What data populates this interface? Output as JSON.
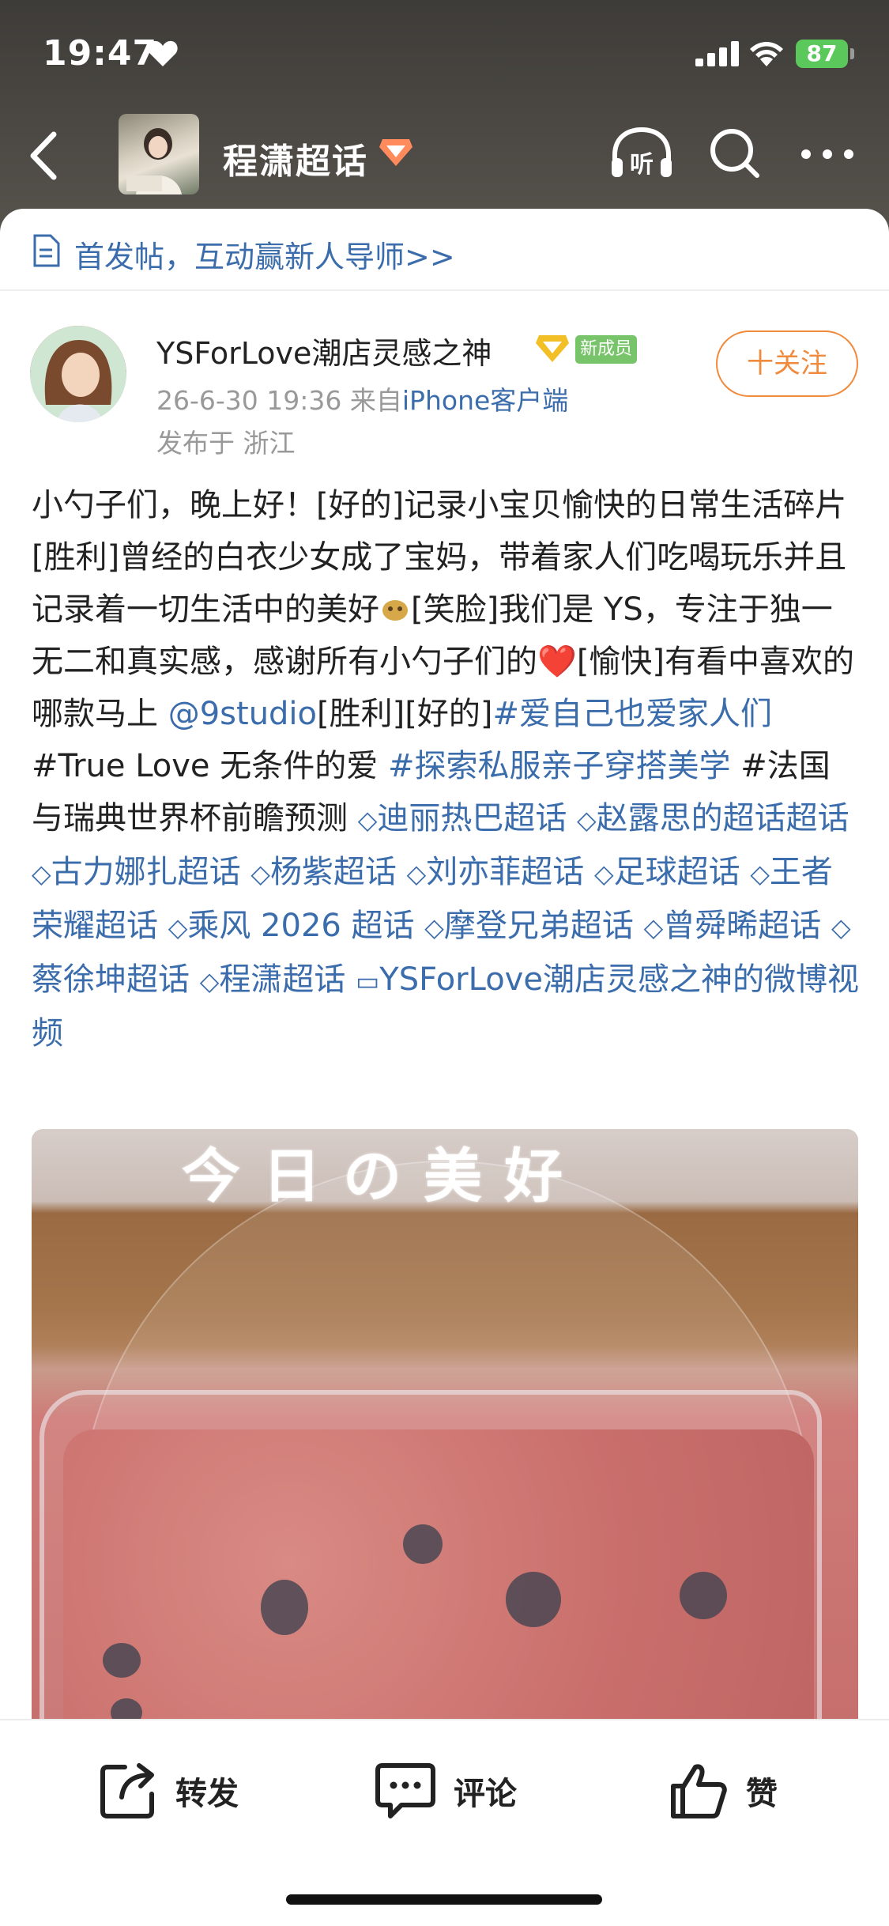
{
  "status_bar": {
    "time": "19:47",
    "battery": "87"
  },
  "nav": {
    "title": "程潇超话"
  },
  "tip": {
    "text": "首发帖，互动赢新人导师>>"
  },
  "post": {
    "username": "YSForLove潮店灵感之神",
    "new_badge": "新成员",
    "follow_label": "十关注",
    "time": "26-6-30 19:36",
    "from_label": "来自",
    "client": "iPhone客户端",
    "location": "发布于 浙江",
    "body": {
      "t1": "小勺子们，晚上好！[好的]记录小宝贝愉快的日常生活碎片[胜利]曾经的白衣少女成了宝妈，带着家人们吃喝玩乐并且记录着一切生活中的美好",
      "t2": "[笑脸]我们是 YS，专注于独一无二和真实感，感谢所有小勺子们的",
      "heart": "❤️",
      "t3": "[愉快]有看中喜欢的哪款马上",
      "mention": "@9studio",
      "t4": "[胜利][好的]",
      "tag1": "#爱自己也爱家人们",
      "t5": " #True Love 无条件的爱 ",
      "tag2": "#探索私服亲子穿搭美学",
      "t6": " #法国与瑞典世界杯前瞻预测",
      "topics": [
        "迪丽热巴超话",
        "赵露思的超话超话",
        "古力娜扎超话",
        "杨紫超话",
        "刘亦菲超话",
        "足球超话",
        "王者荣耀超话",
        "乘风 2026 超话",
        "摩登兄弟超话",
        "曾舜晞超话",
        "蔡徐坤超话",
        "程潇超话"
      ],
      "video_link": "YSForLove潮店灵感之神的微博视频"
    },
    "media_overlay_text": "今日の美好"
  },
  "actions": {
    "repost": "转发",
    "comment": "评论",
    "like": "赞"
  },
  "colors": {
    "link": "#3b6cab",
    "follow": "#f08a3c",
    "badge_green": "#78c46a"
  }
}
